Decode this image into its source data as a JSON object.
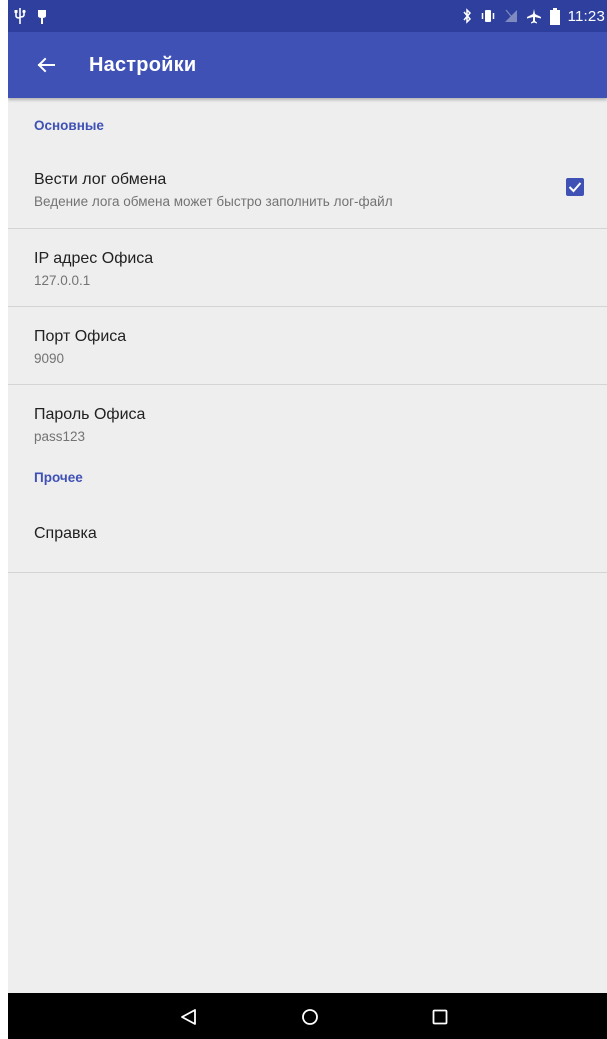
{
  "status_bar": {
    "time": "11:23",
    "left_icons": [
      "usb-icon",
      "notification-icon"
    ],
    "right_icons": [
      "bluetooth-icon",
      "vibrate-icon",
      "no-sim-icon",
      "airplane-icon",
      "battery-icon"
    ]
  },
  "app_bar": {
    "title": "Настройки",
    "back_icon": "arrow-back-icon"
  },
  "sections": [
    {
      "header": "Основные",
      "items": [
        {
          "title": "Вести лог обмена",
          "summary": "Ведение лога обмена может быстро заполнить лог-файл",
          "checked": true
        },
        {
          "title": "IP адрес Офиса",
          "summary": "127.0.0.1"
        },
        {
          "title": "Порт Офиса",
          "summary": "9090"
        },
        {
          "title": "Пароль Офиса",
          "summary": "pass123"
        }
      ]
    },
    {
      "header": "Прочее",
      "items": [
        {
          "title": "Справка"
        }
      ]
    }
  ],
  "colors": {
    "status_bar": "#2f3f9e",
    "app_bar": "#3f51b5",
    "accent": "#3f51b5",
    "background": "#eeeeee",
    "nav_bar": "#000000"
  },
  "nav_bar": {
    "icons": [
      "nav-back-icon",
      "nav-home-icon",
      "nav-recents-icon"
    ]
  }
}
